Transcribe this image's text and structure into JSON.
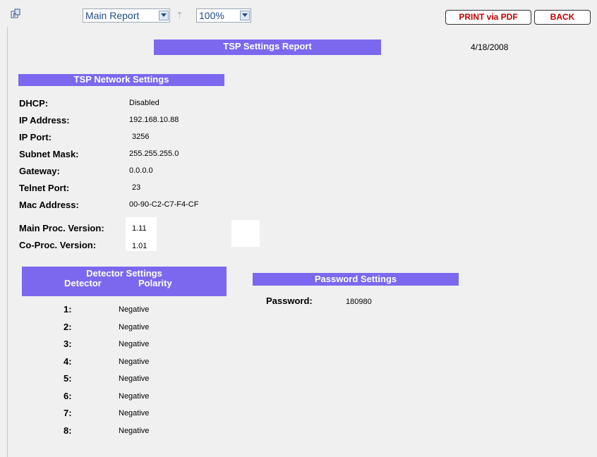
{
  "toolbar": {
    "report_select": "Main Report",
    "zoom_select": "100%",
    "print_label": "PRINT via PDF",
    "back_label": "BACK"
  },
  "report": {
    "title": "TSP Settings Report",
    "date": "4/18/2008"
  },
  "network": {
    "heading": "TSP Network Settings",
    "rows": [
      {
        "label": "DHCP:",
        "value": "Disabled"
      },
      {
        "label": "IP Address:",
        "value": "192.168.10.88"
      },
      {
        "label": "IP Port:",
        "value": "3256"
      },
      {
        "label": "Subnet Mask:",
        "value": "255.255.255.0"
      },
      {
        "label": "Gateway:",
        "value": "0.0.0.0"
      },
      {
        "label": "Telnet Port:",
        "value": "23"
      },
      {
        "label": "Mac Address:",
        "value": "00-90-C2-C7-F4-CF"
      },
      {
        "label": "Main Proc. Version:",
        "value": "1.11"
      },
      {
        "label": "Co-Proc. Version:",
        "value": "1.01"
      }
    ]
  },
  "detector": {
    "heading": "Detector Settings",
    "col_detector": "Detector",
    "col_polarity": "Polarity",
    "rows": [
      {
        "num": "1:",
        "polarity": "Negative"
      },
      {
        "num": "2:",
        "polarity": "Negative"
      },
      {
        "num": "3:",
        "polarity": "Negative"
      },
      {
        "num": "4:",
        "polarity": "Negative"
      },
      {
        "num": "5:",
        "polarity": "Negative"
      },
      {
        "num": "6:",
        "polarity": "Negative"
      },
      {
        "num": "7:",
        "polarity": "Negative"
      },
      {
        "num": "8:",
        "polarity": "Negative"
      }
    ]
  },
  "password": {
    "heading": "Password Settings",
    "label": "Password:",
    "value": "180980"
  }
}
